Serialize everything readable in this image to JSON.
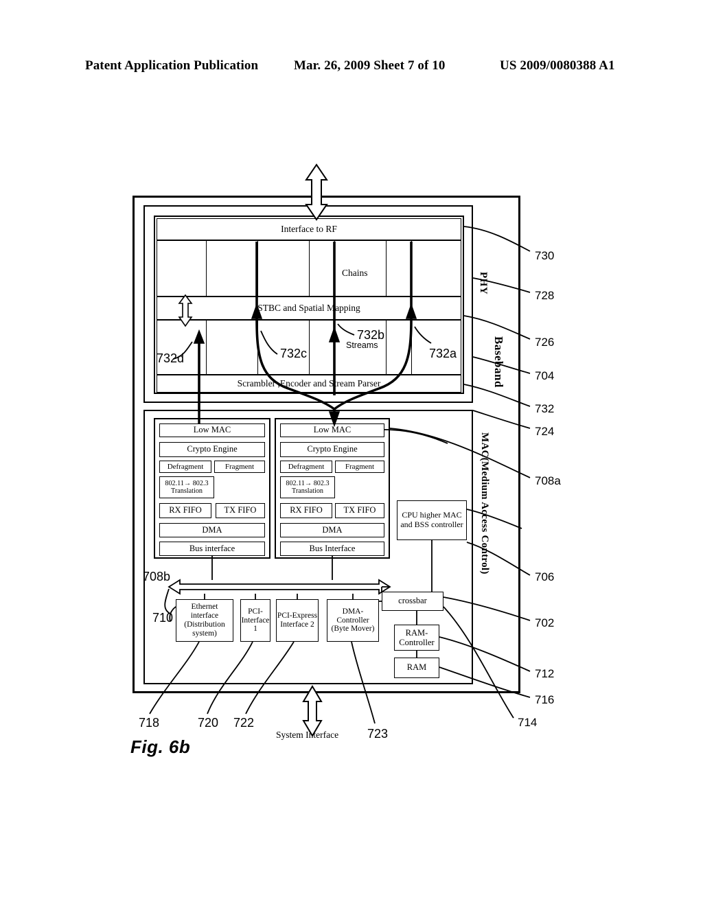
{
  "header": {
    "left": "Patent Application Publication",
    "middle": "Mar. 26, 2009  Sheet 7 of 10",
    "right": "US 2009/0080388 A1"
  },
  "figure": {
    "label": "Fig. 6b",
    "system_interface": "System Interface"
  },
  "phy": {
    "interface_to_rf": "Interface to RF",
    "chains_label": "Chains",
    "stbc": "STBC and Spatial Mapping",
    "streams_label": "Streams",
    "scrambler": "Scrambler ,Encoder and Stream Parser"
  },
  "section_labels": {
    "phy": "PHY",
    "baseband": "Baseband",
    "mac": "MAC(Medium Access Control)"
  },
  "mac_left": {
    "low_mac": "Low MAC",
    "crypto_engine": "Crypto Engine",
    "defragment": "Defragment",
    "fragment": "Fragment",
    "translation": "802.11→ 802.3 Translation",
    "rx_fifo": "RX FIFO",
    "tx_fifo": "TX FIFO",
    "dma": "DMA",
    "bus_interface": "Bus interface"
  },
  "mac_right": {
    "low_mac": "Low MAC",
    "crypto_engine": "Crypto Engine",
    "defragment": "Defragment",
    "fragment": "Fragment",
    "translation": "802.11→ 802.3 Translation",
    "rx_fifo": "RX FIFO",
    "tx_fifo": "TX FIFO",
    "dma": "DMA",
    "bus_interface": "Bus Interface"
  },
  "right_column": {
    "cpu": "CPU higher MAC and BSS controller",
    "crossbar": "crossbar",
    "ram_controller": "RAM-Controller",
    "ram": "RAM"
  },
  "interfaces": {
    "ethernet": "Ethernet interface (Distribution system)",
    "pci1": "PCI-Interface 1",
    "pcie2": "PCI-Express Interface 2",
    "dma_controller": "DMA-Controller (Byte Mover)"
  },
  "reference_numbers": {
    "r730": "730",
    "r728": "728",
    "r726": "726",
    "r704": "704",
    "r732": "732",
    "r724": "724",
    "r708a": "708a",
    "r706": "706",
    "r702": "702",
    "r712": "712",
    "r716": "716",
    "r714": "714",
    "r708b": "708b",
    "r710": "710",
    "r718": "718",
    "r720": "720",
    "r722": "722",
    "r723": "723",
    "r732a": "732a",
    "r732b": "732b",
    "r732c": "732c",
    "r732d": "732d"
  },
  "colors": {
    "ink": "#000000",
    "paper": "#ffffff"
  }
}
